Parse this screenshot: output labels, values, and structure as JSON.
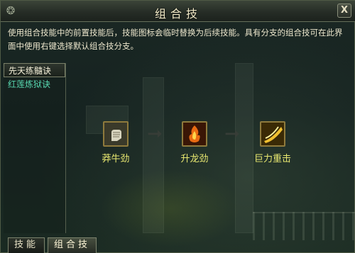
{
  "window": {
    "title": "组合技",
    "close_label": "X",
    "description": "使用组合技能中的前置技能后，技能图标会临时替换为后续技能。具有分支的组合技可在此界面中使用右键选择默认组合技分支。"
  },
  "combo_list": {
    "items": [
      {
        "label": "先天练髓诀"
      },
      {
        "label": "红莲炼狱诀"
      }
    ]
  },
  "combo_chain": {
    "skills": [
      {
        "name": "莽牛劲",
        "icon": "fist-icon"
      },
      {
        "name": "升龙劲",
        "icon": "flame-icon"
      },
      {
        "name": "巨力重击",
        "icon": "strike-icon"
      }
    ]
  },
  "tabs": [
    {
      "label": "技能"
    },
    {
      "label": "组合技"
    }
  ],
  "colors": {
    "skill_name": "#e8e870",
    "subskill_text": "#58d8b0",
    "panel_border": "#7c836d"
  }
}
